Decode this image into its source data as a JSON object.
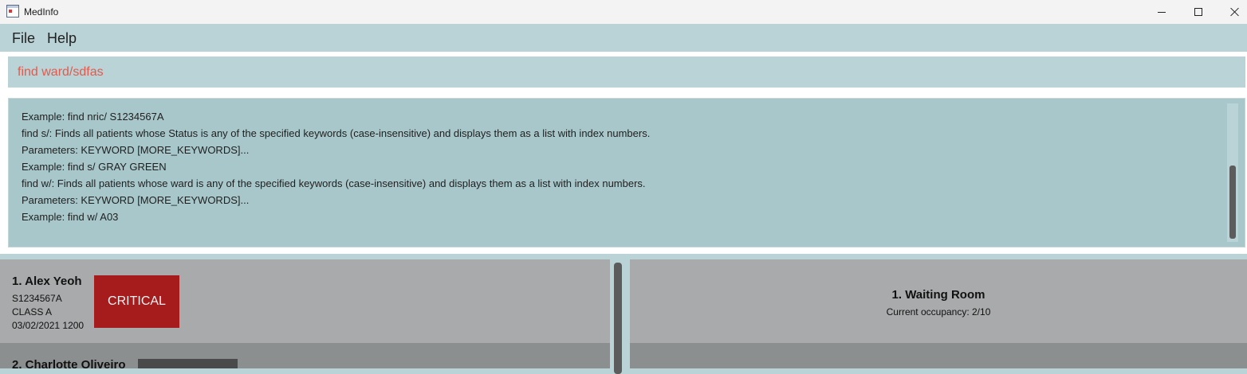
{
  "window": {
    "title": "MedInfo",
    "icon": "app-icon",
    "controls": [
      "minimize-icon",
      "maximize-icon",
      "close-icon"
    ]
  },
  "menu": {
    "file_label": "File",
    "help_label": "Help"
  },
  "command": {
    "value": "find ward/sdfas",
    "text_color": "#e35a4c"
  },
  "result": {
    "lines": [
      "Example: find nric/ S1234567A",
      "find s/: Finds all patients whose Status is any of the specified keywords (case-insensitive) and displays them as a list with index numbers.",
      "Parameters: KEYWORD [MORE_KEYWORDS]...",
      "Example: find s/ GRAY GREEN",
      "find w/: Finds all patients whose ward is any of the specified keywords (case-insensitive) and displays them as a list with index numbers.",
      "Parameters: KEYWORD [MORE_KEYWORDS]...",
      "Example: find w/ A03"
    ]
  },
  "patients": [
    {
      "name": "1.  Alex Yeoh",
      "nric": "S1234567A",
      "ward_class": "CLASS A",
      "datetime": "03/02/2021 1200",
      "status": "CRITICAL",
      "status_color": "#a61c1c"
    },
    {
      "name": "2.  Charlotte Oliveiro",
      "status_color": "#4a4a4a"
    }
  ],
  "wards": [
    {
      "name": "1.  Waiting Room",
      "occupancy": "Current occupancy: 2/10"
    }
  ],
  "colors": {
    "accent": "#b9d3d6",
    "result_bg": "#a8c7ca",
    "card_bg": "#a8aaab",
    "card_alt_bg": "#8c8f90"
  }
}
